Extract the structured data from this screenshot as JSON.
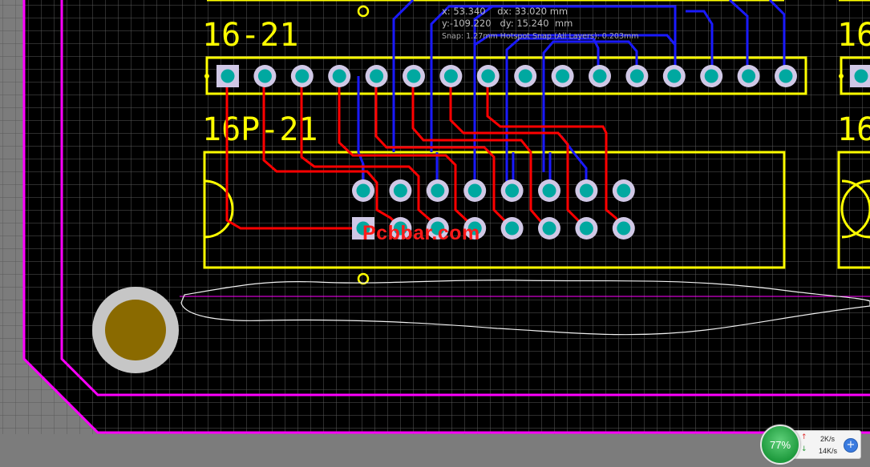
{
  "colors": {
    "background": "#000000",
    "grid": "#5a5a5a",
    "outer_margin": "#7c7c7c",
    "board_outline": "#ff00ff",
    "silkscreen": "#ffff00",
    "top_trace": "#ff0000",
    "bottom_trace": "#1a1aff",
    "pad": "#00a8a0",
    "pad_ring": "#d0c8e6",
    "mount_hole": "#8a6a00",
    "watermark": "#ff1a1a"
  },
  "labels": {
    "header_designator": "16-21",
    "ic_designator": "16P-21",
    "right_header_partial": "16",
    "right_ic_partial": "16"
  },
  "coordinate_readout": {
    "x": "x: 53.340",
    "dx": "dx: 33.020 mm",
    "y": "y:-109.220",
    "dy": "dy: 15.240  mm",
    "snap": "Snap: 1.27mm Hotspot Snap (All Layers): 0.203mm"
  },
  "watermark": "Pcbbar.com",
  "net_monitor": {
    "percent": "77%",
    "upload_rate": "2K/s",
    "download_rate": "14K/s",
    "upload_icon": "arrow-up-icon",
    "download_icon": "arrow-down-icon",
    "boost_icon": "plus-icon"
  }
}
